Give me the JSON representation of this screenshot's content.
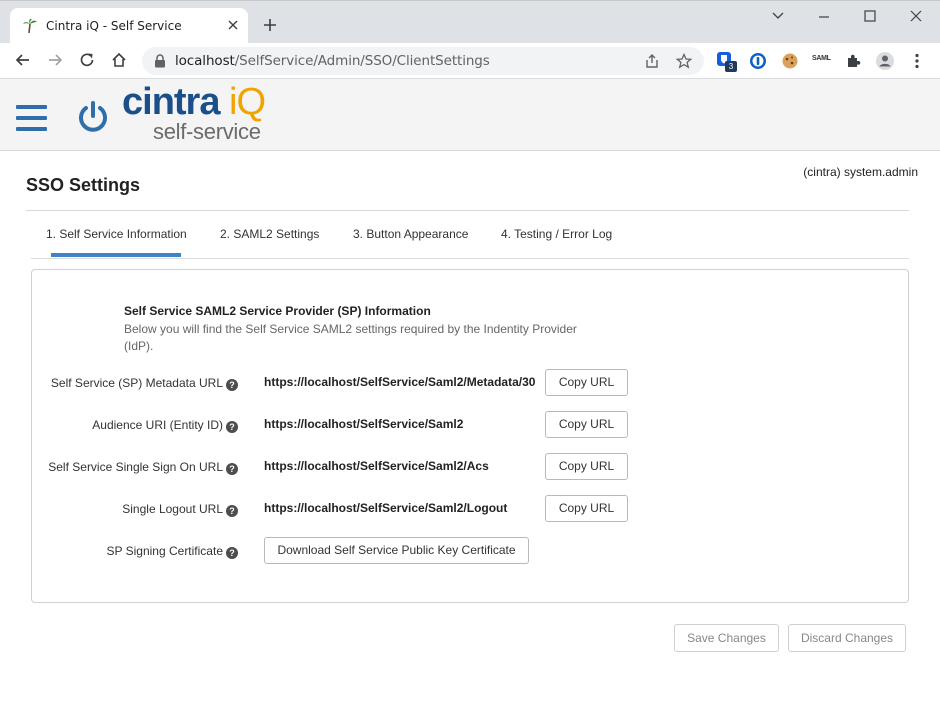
{
  "browser": {
    "tab_title": "Cintra iQ - Self Service",
    "url_host": "localhost",
    "url_path": "/SelfService/Admin/SSO/ClientSettings",
    "badge_count": "3",
    "saml_ext": "SAML"
  },
  "header": {
    "logo_main": "cintra",
    "logo_iq": "iQ",
    "logo_sub": "self-service"
  },
  "user": {
    "display": "(cintra) system.admin"
  },
  "page": {
    "title": "SSO Settings"
  },
  "tabs": [
    {
      "label": "1. Self Service Information"
    },
    {
      "label": "2. SAML2 Settings"
    },
    {
      "label": "3. Button Appearance"
    },
    {
      "label": "4. Testing / Error Log"
    }
  ],
  "info": {
    "title": "Self Service SAML2 Service Provider (SP) Information",
    "description": "Below you will find the Self Service SAML2 settings required by the Indentity Provider (IdP)."
  },
  "rows": [
    {
      "label": "Self Service (SP) Metadata URL",
      "value": "https://localhost/SelfService/Saml2/Metadata/30",
      "button": "Copy URL"
    },
    {
      "label": "Audience URI (Entity ID)",
      "value": "https://localhost/SelfService/Saml2",
      "button": "Copy URL"
    },
    {
      "label": "Self Service Single Sign On URL",
      "value": "https://localhost/SelfService/Saml2/Acs",
      "button": "Copy URL"
    },
    {
      "label": "Single Logout URL",
      "value": "https://localhost/SelfService/Saml2/Logout",
      "button": "Copy URL"
    }
  ],
  "certificate": {
    "label": "SP Signing Certificate",
    "button": "Download Self Service Public Key Certificate"
  },
  "footer": {
    "save": "Save Changes",
    "discard": "Discard Changes"
  },
  "help_glyph": "?"
}
